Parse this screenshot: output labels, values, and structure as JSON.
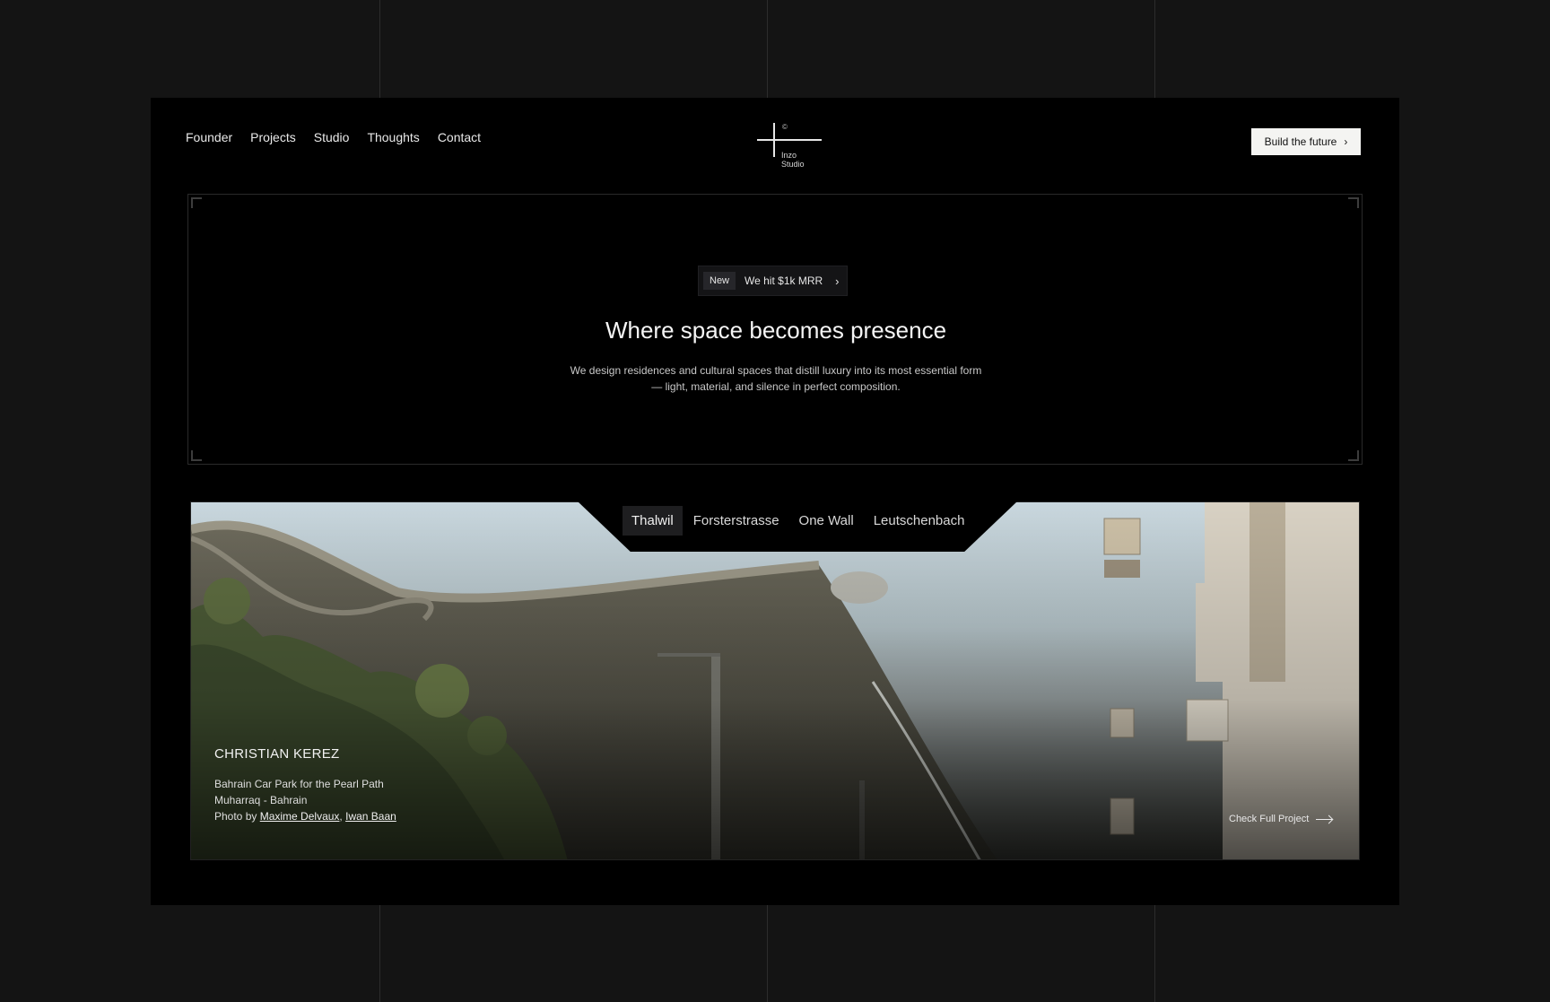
{
  "nav": {
    "items": [
      {
        "label": "Founder"
      },
      {
        "label": "Projects"
      },
      {
        "label": "Studio"
      },
      {
        "label": "Thoughts"
      },
      {
        "label": "Contact"
      }
    ]
  },
  "logo": {
    "copyright": "©",
    "line1": "Inzo",
    "line2": "Studio"
  },
  "cta": {
    "label": "Build the future",
    "icon": "chevron-right-icon"
  },
  "hero": {
    "badge": "New",
    "announcement": "We hit $1k MRR",
    "title": "Where space becomes presence",
    "subtitle": "We design residences and cultural spaces that distill luxury into its most essential form — light, material, and silence in perfect composition."
  },
  "tabs": [
    {
      "label": "Thalwil",
      "active": true
    },
    {
      "label": "Forsterstrasse",
      "active": false
    },
    {
      "label": "One Wall",
      "active": false
    },
    {
      "label": "Leutschenbach",
      "active": false
    }
  ],
  "project": {
    "architect": "CHRISTIAN KEREZ",
    "name": "Bahrain Car Park for the Pearl Path",
    "location": "Muharraq - Bahrain",
    "photo_prefix": "Photo by",
    "photographer1": "Maxime Delvaux",
    "separator": ",",
    "photographer2": "Iwan Baan",
    "link_label": "Check Full Project",
    "link_icon": "arrow-right-icon"
  },
  "colors": {
    "page_bg": "#141414",
    "frame_bg": "#000000",
    "cta_bg": "#f4f4f2"
  }
}
